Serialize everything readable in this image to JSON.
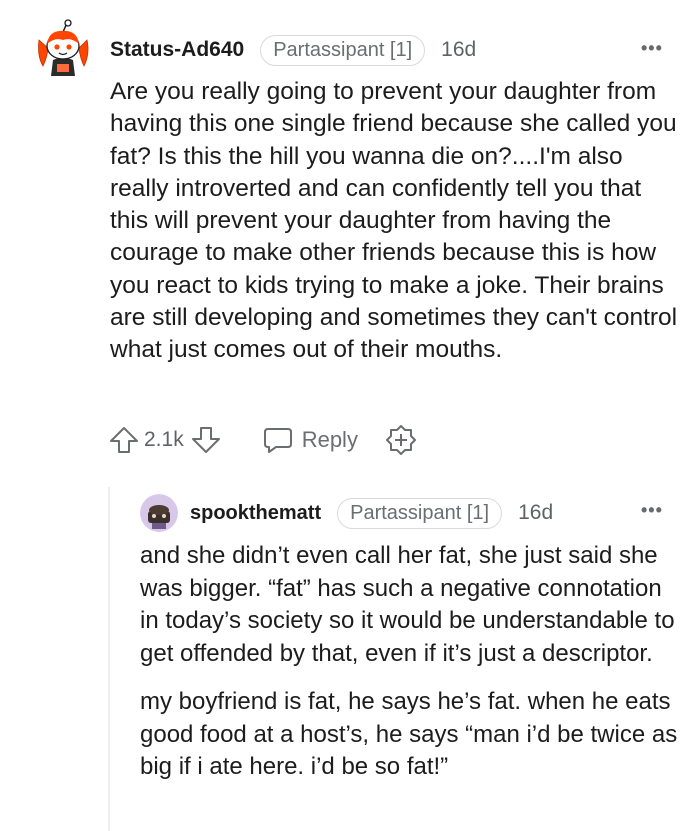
{
  "comments": [
    {
      "username": "Status-Ad640",
      "flair": "Partassipant [1]",
      "age": "16d",
      "body": "Are you really going to prevent your daughter from having this one single friend because she called you fat? Is this the hill you wanna die on?....I'm also really introverted and can confidently tell you that this will prevent your daughter from having the courage to make other friends because this is how you react to kids trying to make a joke. Their brains are still developing and sometimes they can't control what just comes out of their mouths.",
      "vote_count": "2.1k",
      "reply_label": "Reply",
      "more_icon": "more-options-icon"
    },
    {
      "username": "spookthematt",
      "flair": "Partassipant [1]",
      "age": "16d",
      "paragraphs": [
        "and she didn’t even call her fat, she just said she was bigger. “fat” has such a negative connotation in today’s society so it would be understandable to get offended by that, even if it’s just a descriptor.",
        "my boyfriend is fat, he says he’s fat. when he eats good food at a host’s, he says “man i’d be twice as big if i ate here. i’d be so fat!”"
      ],
      "more_icon": "more-options-icon"
    }
  ],
  "colors": {
    "text": "#1c1c1c",
    "meta": "#6b6e70",
    "flair_border": "#d7dadc",
    "thread_line": "#edeff1",
    "avatar_orange": "#ff4500"
  }
}
